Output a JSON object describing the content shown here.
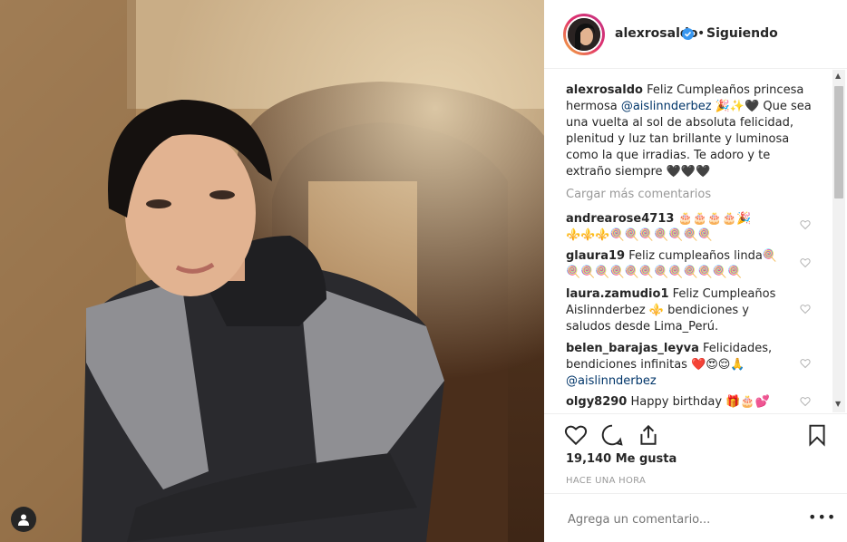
{
  "header": {
    "username": "alexrosaldo",
    "separator": "•",
    "follow_status": "Siguiendo"
  },
  "caption": {
    "username": "alexrosaldo",
    "text_before": "Feliz Cumpleaños princesa hermosa ",
    "mention": "@aislinnderbez",
    "text_after": " 🎉✨🖤 Que sea una vuelta al sol de absoluta felicidad, plenitud y luz tan brillante y luminosa como la que irradias. Te adoro y te extraño siempre 🖤🖤🖤"
  },
  "load_more": "Cargar más comentarios",
  "comments": [
    {
      "username": "andrearose4713",
      "text": "🎂🎂🎂🎂🎉⚜️⚜️⚜️🍭🍭🍭🍭🍭🍭🍭"
    },
    {
      "username": "glaura19",
      "text": "Feliz cumpleaños linda🍭🍭🍭🍭🍭🍭🍭🍭🍭🍭🍭🍭🍭"
    },
    {
      "username": "laura.zamudio1",
      "text": "Feliz Cumpleaños Aislinnderbez ⚜️ bendiciones y saludos desde Lima_Perú."
    },
    {
      "username": "belen_barajas_leyva",
      "text": "Felicidades, bendiciones infinitas ❤️😍😌🙏",
      "mention": "@aislinnderbez"
    },
    {
      "username": "olgy8290",
      "text": "Happy birthday 🎁🎂💕"
    }
  ],
  "icons": {
    "like": "heart-icon",
    "comment": "comment-icon",
    "share": "share-icon",
    "save": "bookmark-icon",
    "tag": "user-tag-icon"
  },
  "likes": "19,140 Me gusta",
  "timestamp": "HACE UNA HORA",
  "add_comment": {
    "placeholder": "Agrega un comentario...",
    "more": "•••"
  },
  "colors": {
    "verified": "#3897f0",
    "mention": "#003569",
    "muted": "#999999"
  }
}
